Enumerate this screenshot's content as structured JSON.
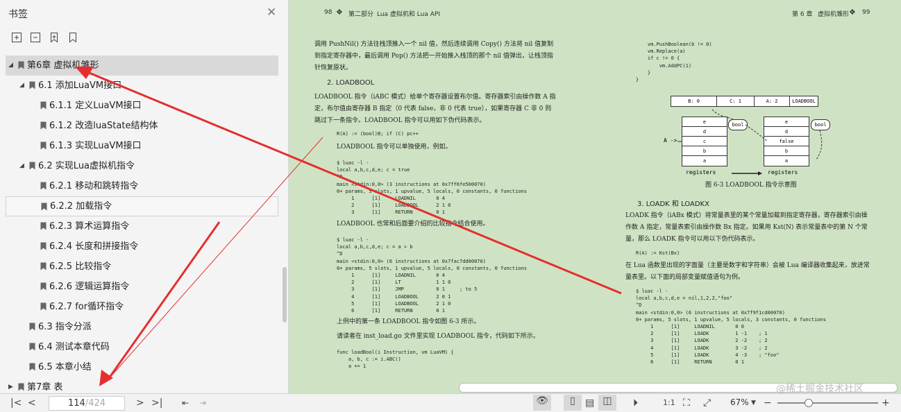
{
  "sidebar": {
    "title": "书签",
    "items": [
      {
        "label": "第6章 虚拟机雏形",
        "level": 0,
        "expanded": true,
        "selected": true
      },
      {
        "label": "6.1 添加LuaVM接口",
        "level": 1,
        "expanded": true
      },
      {
        "label": "6.1.1 定义LuaVM接口",
        "level": 2
      },
      {
        "label": "6.1.2 改造luaState结构体",
        "level": 2
      },
      {
        "label": "6.1.3 实现LuaVM接口",
        "level": 2
      },
      {
        "label": "6.2 实现Lua虚拟机指令",
        "level": 1,
        "expanded": true
      },
      {
        "label": "6.2.1 移动和跳转指令",
        "level": 2
      },
      {
        "label": "6.2.2 加载指令",
        "level": 2,
        "hover": true
      },
      {
        "label": "6.2.3 算术运算指令",
        "level": 2
      },
      {
        "label": "6.2.4 长度和拼接指令",
        "level": 2
      },
      {
        "label": "6.2.5 比较指令",
        "level": 2
      },
      {
        "label": "6.2.6 逻辑运算指令",
        "level": 2
      },
      {
        "label": "6.2.7 for循环指令",
        "level": 2
      },
      {
        "label": "6.3 指令分派",
        "level": 1
      },
      {
        "label": "6.4 测试本章代码",
        "level": 1
      },
      {
        "label": "6.5 本章小结",
        "level": 1
      },
      {
        "label": "第7章 表",
        "level": 0,
        "expanded": false
      }
    ]
  },
  "doc": {
    "left_header": {
      "page": "98",
      "part": "第二部分",
      "section": "Lua 虚拟机和 Lua API"
    },
    "right_header": {
      "chapter": "第 6 章",
      "title": "虚拟机雏形",
      "page": "99"
    },
    "left": {
      "p1": "调用 PushNil() 方法往栈顶推入一个 nil 值，然后连续调用 Copy() 方法将 nil 值复制到指定寄存器中，最后调用 Pop() 方法把一开始推入栈顶的那个 nil 值弹出，让栈顶指针恢复原状。",
      "h2": "2. LOADBOOL",
      "p2": "LOADBOOL 指令（iABC 模式）给单个寄存器设置布尔值。寄存器索引由操作数 A 指定，布尔值由寄存器 B 指定（0 代表 false，非 0 代表 true），如果寄存器 C 非 0 则跳过下一条指令。LOADBOOL 指令可以用如下伪代码表示。",
      "code1": "R(A) := (bool)B; if (C) pc++",
      "p3": "LOADBOOL 指令可以单独使用，例如。",
      "code2": "$ luac -l -\nlocal a,b,c,d,e; c = true\n^D\nmain <stdin:0,0> (3 instructions at 0x7ff6fe500070)\n0+ params, 5 slots, 1 upvalue, 5 locals, 0 constants, 0 functions\n     1      [1]     LOADNIL       0 4\n     2      [1]     LOADBOOL      2 1 0\n     3      [1]     RETURN        0 1",
      "p4": "LOADBOOL 也常和后面要介绍的比较指令结合使用。",
      "code3": "$ luac -l -\nlocal a,b,c,d,e; c = a > b\n^D\nmain <stdin:0,0> (6 instructions at 0x7fac7dd00070)\n0+ params, 5 slots, 1 upvalue, 5 locals, 0 constants, 0 functions\n     1      [1]     LOADNIL       0 4\n     2      [1]     LT            1 1 0\n     3      [1]     JMP           0 1     ; to 5\n     4      [1]     LOADBOOL      2 0 1\n     5      [1]     LOADBOOL      2 1 0\n     6      [1]     RETURN        0 1",
      "p5": "上例中的第一条 LOADBOOL 指令如图 6-3 所示。",
      "p6": "请读者在 inst_load.go 文件里实现 LOADBOOL 指令，代码如下所示。",
      "code4": "func loadBool(i Instruction, vm LuaVM) {\n    a, b, c := i.ABC()\n    a += 1"
    },
    "right": {
      "code5": "    vm.PushBoolean(b != 0)\n    vm.Replace(a)\n    if c != 0 {\n        vm.AddPC(1)\n    }\n}",
      "diagram": {
        "b_label": "B: 0",
        "c_label": "C: 1",
        "a_label": "A: 2",
        "op_label": "LOADBOOL",
        "left_regs": [
          "e",
          "d",
          "c",
          "b",
          "a"
        ],
        "right_regs": [
          "e",
          "d",
          "false",
          "b",
          "a"
        ],
        "bool1": "bool",
        "bool2": "bool",
        "a_arrow": "A ->",
        "reg_left": "registers",
        "reg_right": "registers"
      },
      "caption": "图 6-3   LOADBOOL 指令示意图",
      "h3": "3. LOADK 和 LOADKX",
      "p7": "LOADK 指令（iABx 模式）将常量表里的某个常量加载到指定寄存器，寄存器索引由操作数 A 指定，常量表索引由操作数 Bx 指定。如果用 Kst(N) 表示常量表中的第 N 个常量，那么 LOADK 指令可以用以下伪代码表示。",
      "code6": "R(A) := Kst(Bx)",
      "p8": "在 Lua 函数里出现的字面量（主要是数字和字符串）会被 Lua 编译器收集起来，放进常量表里。以下面的局部变量赋值语句为例。",
      "code7": "$ luac -l -\nlocal a,b,c,d,e = nil,1,2,2,\"foo\"\n^D\nmain <stdin:0,0> (6 instructions at 0x7f9f1cd00070)\n0+ params, 5 slots, 1 upvalue, 5 locals, 3 constants, 0 functions\n     1      [1]     LOADNIL       0 0\n     2      [1]     LOADK         1 -1    ; 1\n     3      [1]     LOADK         2 -2    ; 2\n     4      [1]     LOADK         3 -2    ; 2\n     5      [1]     LOADK         4 -3    ; \"foo\"\n     6      [1]     RETURN        0 1"
    }
  },
  "statusbar": {
    "current_page": "114",
    "total_pages": "/424",
    "zoom": "67%",
    "zoom_minus": "−",
    "zoom_plus": "+",
    "zoom_level": 0.3
  },
  "watermark": "@稀土掘金技术社区"
}
